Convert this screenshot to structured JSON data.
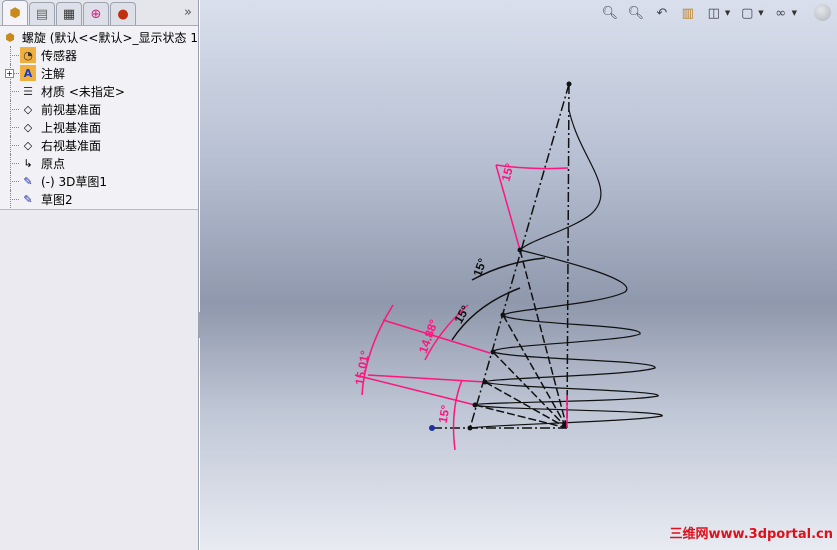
{
  "panel": {
    "tabs": [
      "feature-manager",
      "property-manager",
      "configuration-manager",
      "dimxpert-manager",
      "display-manager"
    ],
    "more": "»",
    "tree": {
      "root": "螺旋   (默认<<默认>_显示状态 1",
      "items": [
        {
          "label": "传感器",
          "icon": "sensor-folder-icon"
        },
        {
          "label": "注解",
          "icon": "annotation-folder-icon",
          "expandable": true
        },
        {
          "label": "材质 <未指定>",
          "icon": "material-icon"
        },
        {
          "label": "前视基准面",
          "icon": "plane-icon"
        },
        {
          "label": "上视基准面",
          "icon": "plane-icon"
        },
        {
          "label": "右视基准面",
          "icon": "plane-icon"
        },
        {
          "label": "原点",
          "icon": "origin-icon"
        },
        {
          "label": "(-) 3D草图1",
          "icon": "3d-sketch-icon"
        },
        {
          "label": "草图2",
          "icon": "sketch-icon"
        }
      ]
    }
  },
  "toolbar": [
    "zoom-to-fit",
    "zoom-to-area",
    "previous-view",
    "section-view",
    "view-orientation",
    "display-style",
    "hide-show-items",
    "appearance"
  ],
  "dimensions": {
    "d1": "15°",
    "d2": "15°",
    "d3": "15°",
    "d4": "14.88°",
    "d5": "15.01°",
    "d6": "15°"
  },
  "watermark": "三维网www.3dportal.cn",
  "colors": {
    "dimension": "#ff1480",
    "sketch": "#111111"
  }
}
